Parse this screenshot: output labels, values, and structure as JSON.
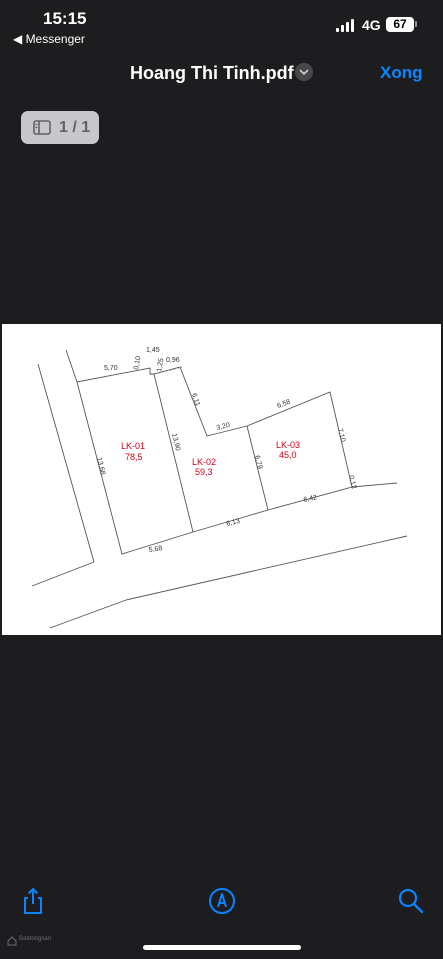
{
  "status_bar": {
    "time": "15:15",
    "back_app": "◀ Messenger",
    "network": "4G",
    "battery": "67"
  },
  "nav": {
    "title": "Hoang Thi Tinh.pdf",
    "done_label": "Xong"
  },
  "page_indicator": {
    "label": "1 / 1"
  },
  "document": {
    "lots": [
      {
        "name": "LK-01",
        "area": "78,5"
      },
      {
        "name": "LK-02",
        "area": "59,3"
      },
      {
        "name": "LK-03",
        "area": "45,0"
      }
    ],
    "dimensions": [
      "1,45",
      "5,70",
      "0,10",
      "1,25",
      "0,96",
      "6,11",
      "6,58",
      "3,20",
      "7,10",
      "13,68",
      "13,90",
      "6,79",
      "0,12",
      "6,42",
      "6,13",
      "5,68"
    ]
  },
  "toolbar": {
    "share_icon": "share-icon",
    "markup_icon": "markup-icon",
    "search_icon": "search-icon"
  },
  "watermark": {
    "text": "Batdongsan"
  },
  "colors": {
    "background": "#1d1d1f",
    "accent": "#0a84ff",
    "lot_label": "#d0021b"
  }
}
